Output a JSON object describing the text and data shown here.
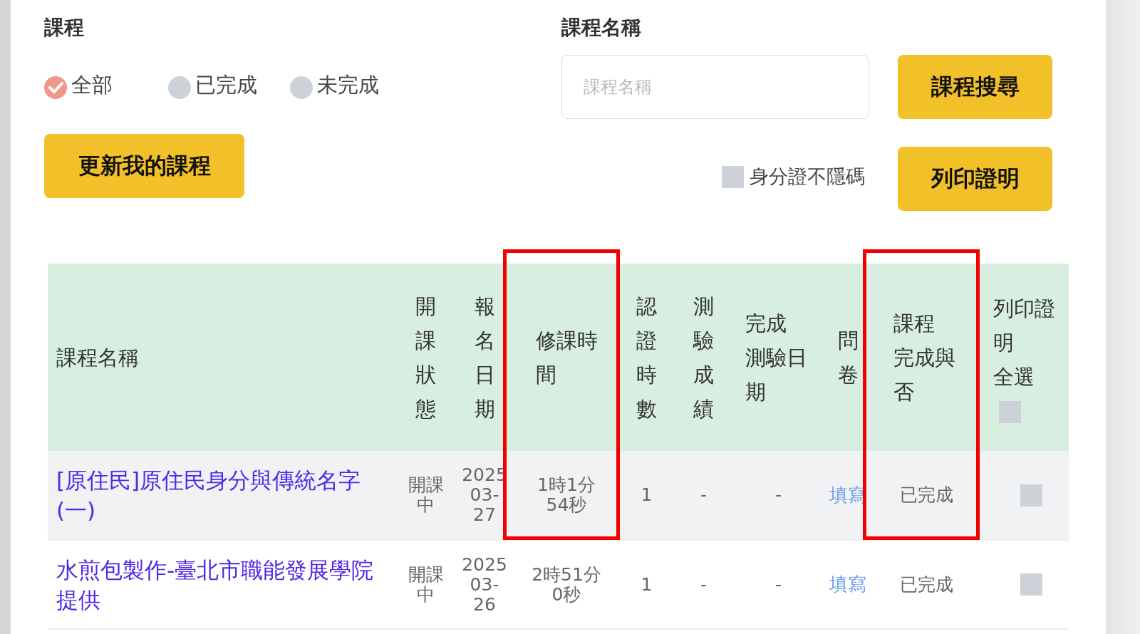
{
  "filters": {
    "course_label": "課程",
    "radios": [
      {
        "label": "全部",
        "selected": true
      },
      {
        "label": "已完成",
        "selected": false
      },
      {
        "label": "未完成",
        "selected": false
      }
    ],
    "name_label": "課程名稱",
    "search": {
      "placeholder": "課程名稱"
    },
    "search_button": "課程搜尋"
  },
  "actions": {
    "update_button": "更新我的課程",
    "id_checkbox": {
      "label": "身分證不隱碼",
      "checked": false
    },
    "print_button": "列印證明"
  },
  "table": {
    "columns": [
      {
        "lines": [
          "課程名稱"
        ],
        "highlighted": false
      },
      {
        "lines": [
          "開課狀態"
        ],
        "highlighted": false
      },
      {
        "lines": [
          "報名日期"
        ],
        "highlighted": false
      },
      {
        "lines": [
          "修課時間"
        ],
        "highlighted": true
      },
      {
        "lines": [
          "認證時數"
        ],
        "highlighted": false
      },
      {
        "lines": [
          "測驗成績"
        ],
        "highlighted": false
      },
      {
        "lines": [
          "完成",
          "測驗日期"
        ],
        "highlighted": false
      },
      {
        "lines": [
          "問卷"
        ],
        "highlighted": false
      },
      {
        "lines": [
          "課程",
          "完成與否"
        ],
        "highlighted": true
      },
      {
        "lines": [
          "列印證明",
          "全選"
        ],
        "highlighted": false,
        "checkbox": {
          "checked": false
        }
      }
    ],
    "rows": [
      {
        "name": "[原住民]原住民身分與傳統名字(一)",
        "status": "開課中",
        "date": [
          "2025",
          "03-",
          "27"
        ],
        "time": [
          "1時1分",
          "54秒"
        ],
        "hours": "1",
        "score": "-",
        "test_date": "-",
        "survey": "填寫",
        "done": "已完成",
        "print_checked": false
      },
      {
        "name": "水煎包製作-臺北市職能發展學院提供",
        "status": "開課中",
        "date": [
          "2025",
          "03-",
          "26"
        ],
        "time": [
          "2時51分",
          "0秒"
        ],
        "hours": "1",
        "score": "-",
        "test_date": "-",
        "survey": "填寫",
        "done": "已完成",
        "print_checked": false
      }
    ]
  }
}
